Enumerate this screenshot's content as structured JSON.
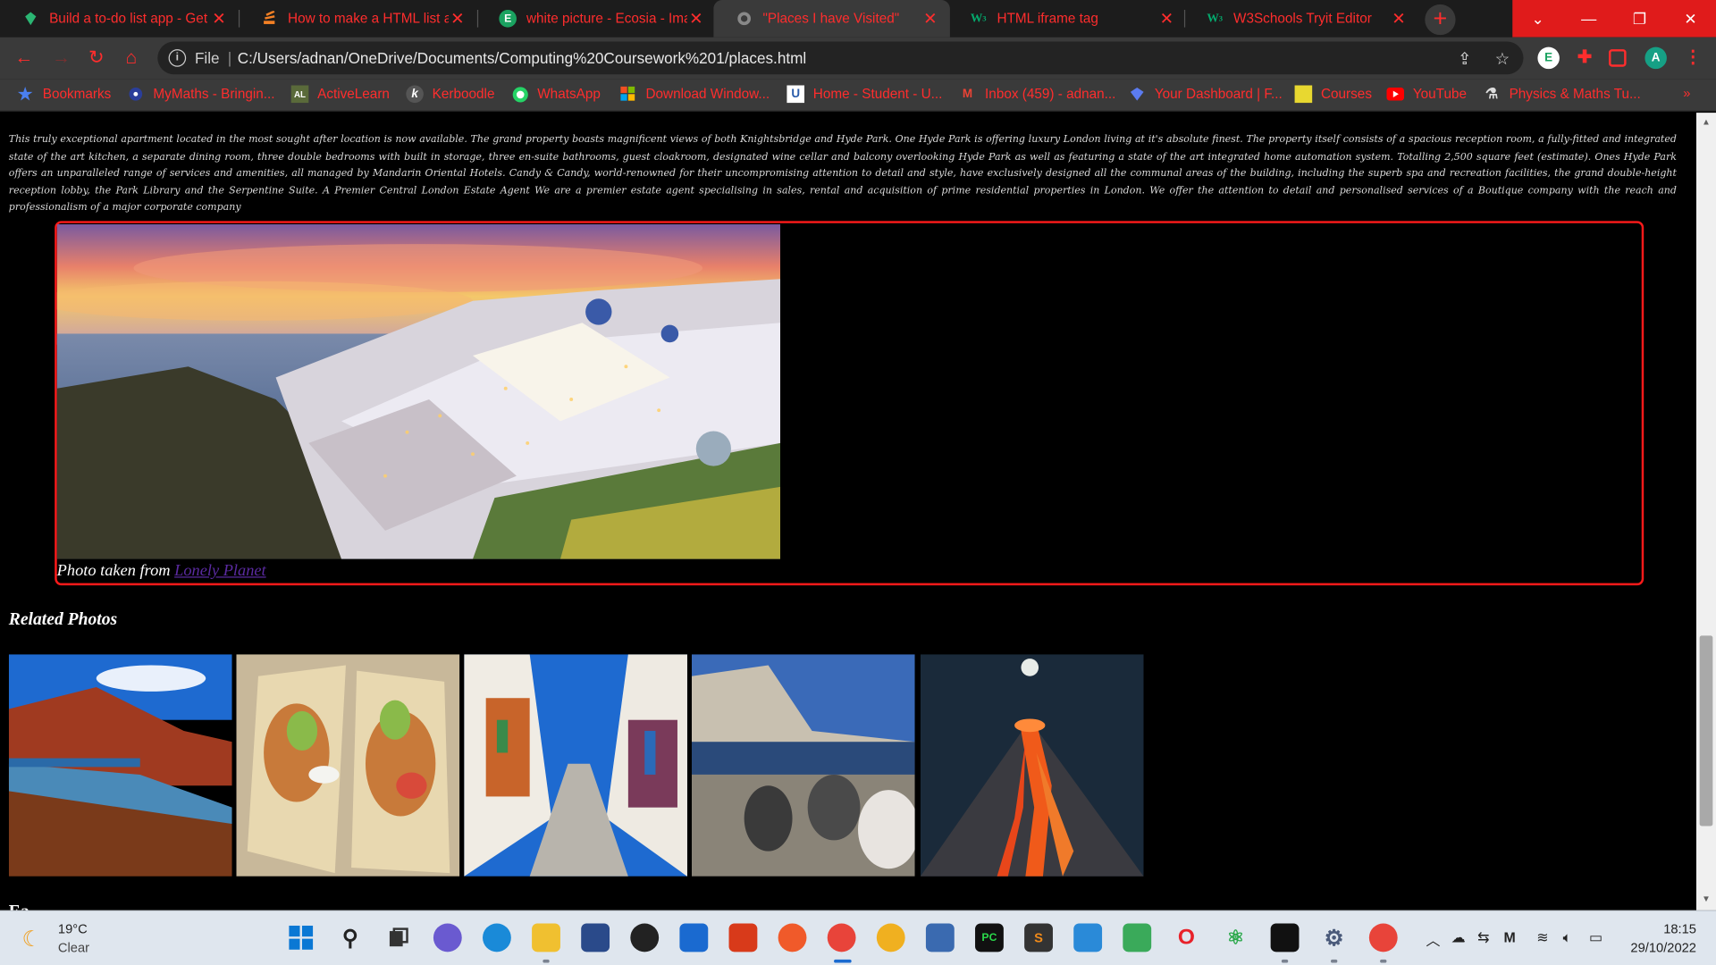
{
  "browser": {
    "tabs": [
      {
        "title": "Build a to-do list app - Get",
        "icon": "gem-icon",
        "color": "#2bb673"
      },
      {
        "title": "How to make a HTML list a",
        "icon": "stack-icon",
        "color": "#f48024"
      },
      {
        "title": "white picture - Ecosia - Ima",
        "icon": "ecosia-icon",
        "color": "#1aa260"
      },
      {
        "title": "\"Places I have Visited\"",
        "icon": "globe-icon",
        "color": "#888888"
      },
      {
        "title": "HTML iframe tag",
        "icon": "w3schools-icon",
        "color": "#04aa6d"
      },
      {
        "title": "W3Schools Tryit Editor",
        "icon": "w3schools-icon",
        "color": "#04aa6d"
      }
    ],
    "active_tab": 3,
    "address": {
      "scheme_label": "File",
      "url": "C:/Users/adnan/OneDrive/Documents/Computing%20Coursework%201/places.html"
    },
    "profile_initial": "A",
    "ext_initial": "E",
    "bookmarks": [
      {
        "label": "Bookmarks",
        "icon": "star-icon"
      },
      {
        "label": "MyMaths - Bringin...",
        "icon": "mymaths-icon"
      },
      {
        "label": "ActiveLearn",
        "icon": "activelearn-icon",
        "glyph": "AL"
      },
      {
        "label": "Kerboodle",
        "icon": "kerboodle-icon",
        "glyph": "k"
      },
      {
        "label": "WhatsApp",
        "icon": "whatsapp-icon"
      },
      {
        "label": "Download Window...",
        "icon": "microsoft-icon"
      },
      {
        "label": "Home - Student - U...",
        "icon": "unifrog-icon",
        "glyph": "U"
      },
      {
        "label": "Inbox (459) - adnan...",
        "icon": "gmail-icon",
        "glyph": "M"
      },
      {
        "label": "Your Dashboard | F...",
        "icon": "diamond-icon"
      },
      {
        "label": "Courses",
        "icon": "courses-icon"
      },
      {
        "label": "YouTube",
        "icon": "youtube-icon"
      },
      {
        "label": "Physics & Maths Tu...",
        "icon": "pmt-icon"
      }
    ],
    "bookmarks_more": "»"
  },
  "page": {
    "description": "This truly exceptional apartment located in the most sought after location is now available. The grand property boasts magnificent views of both Knightsbridge and Hyde Park. One Hyde Park is offering luxury London living at it's absolute finest. The property itself consists of a spacious reception room, a fully-fitted and integrated state of the art kitchen, a separate dining room, three double bedrooms with built in storage, three en-suite bathrooms, guest cloakroom, designated wine cellar and balcony overlooking Hyde Park as well as featuring a state of the art integrated home automation system. Totalling 2,500 square feet (estimate). Ones Hyde Park offers an unparalleled range of services and amenities, all managed by Mandarin Oriental Hotels. Candy & Candy, world-renowned for their uncompromising attention to detail and style, have exclusively designed all the communal areas of the building, including the superb spa and recreation facilities, the grand double-height reception lobby, the Park Library and the Serpentine Suite. A Premier Central London Estate Agent We are a premier estate agent specialising in sales, rental and acquisition of prime residential properties in London. We offer the attention to detail and personalised services of a Boutique company with the reach and professionalism of a major corporate company",
    "caption_prefix": "Photo taken from ",
    "caption_link": "Lonely Planet",
    "related_heading": "Related Photos",
    "cutoff_heading": "Ea"
  },
  "taskbar": {
    "weather_temp": "19°C",
    "weather_condition": "Clear",
    "clock_time": "18:15",
    "clock_date": "29/10/2022"
  }
}
